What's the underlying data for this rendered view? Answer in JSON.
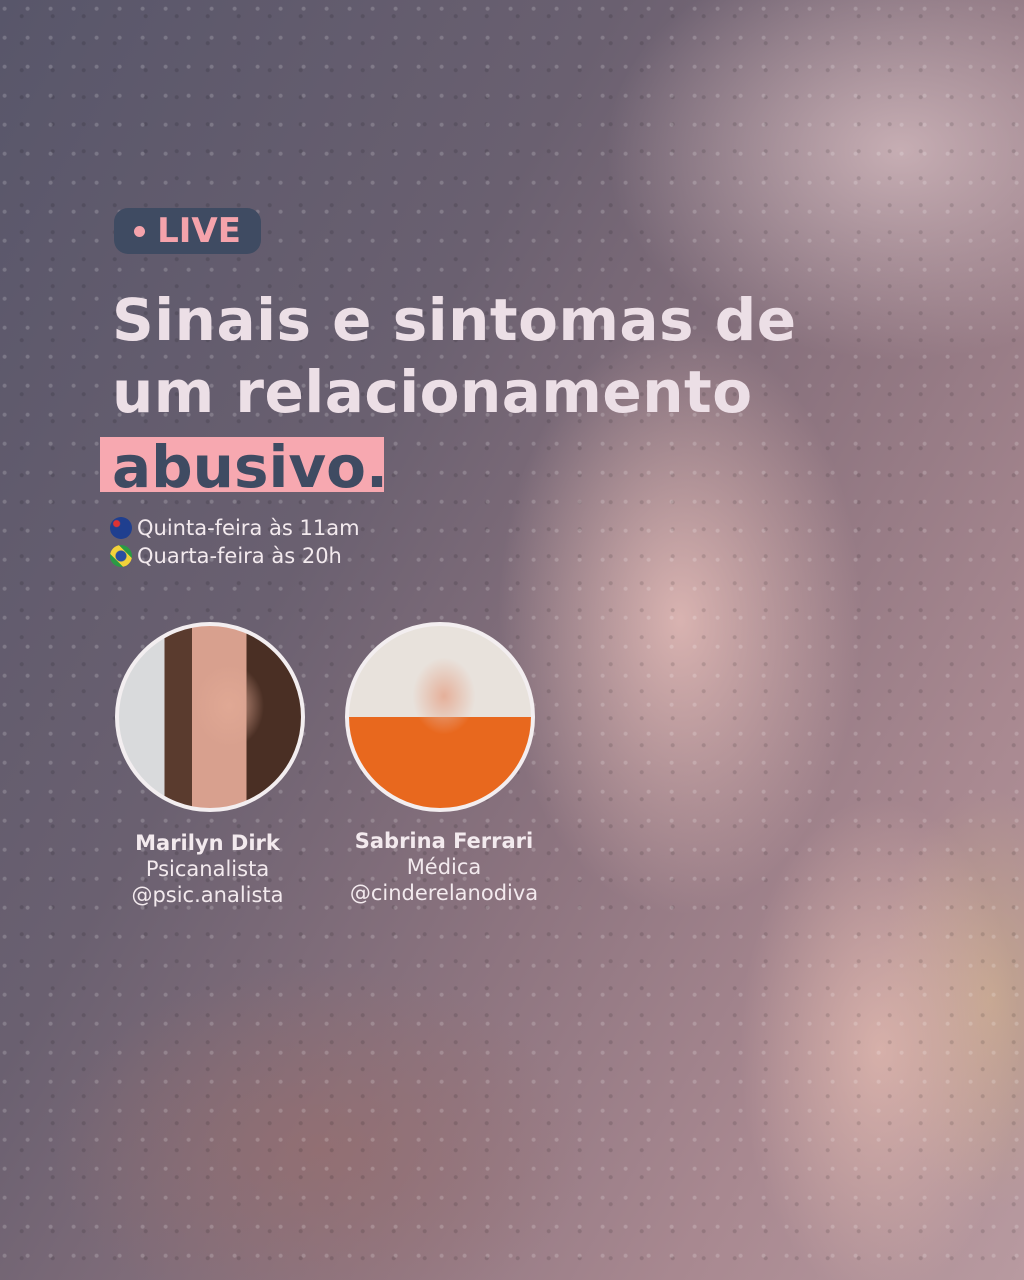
{
  "badge": {
    "label": "LIVE"
  },
  "title": {
    "line1": "Sinais e sintomas de",
    "line2": "um relacionamento",
    "highlight": "abusivo."
  },
  "schedule": [
    {
      "flag": "australia-flag-icon",
      "text": "Quinta-feira às 11am"
    },
    {
      "flag": "brazil-flag-icon",
      "text": "Quarta-feira às 20h"
    }
  ],
  "speakers": [
    {
      "name": "Marilyn Dirk",
      "role": "Psicanalista",
      "handle": "@psic.analista"
    },
    {
      "name": "Sabrina Ferrari",
      "role": "Médica",
      "handle": "@cinderelanodiva"
    }
  ],
  "colors": {
    "accent": "#f7a8b0",
    "dark": "#3f4b62",
    "text": "#ecdfe6"
  }
}
